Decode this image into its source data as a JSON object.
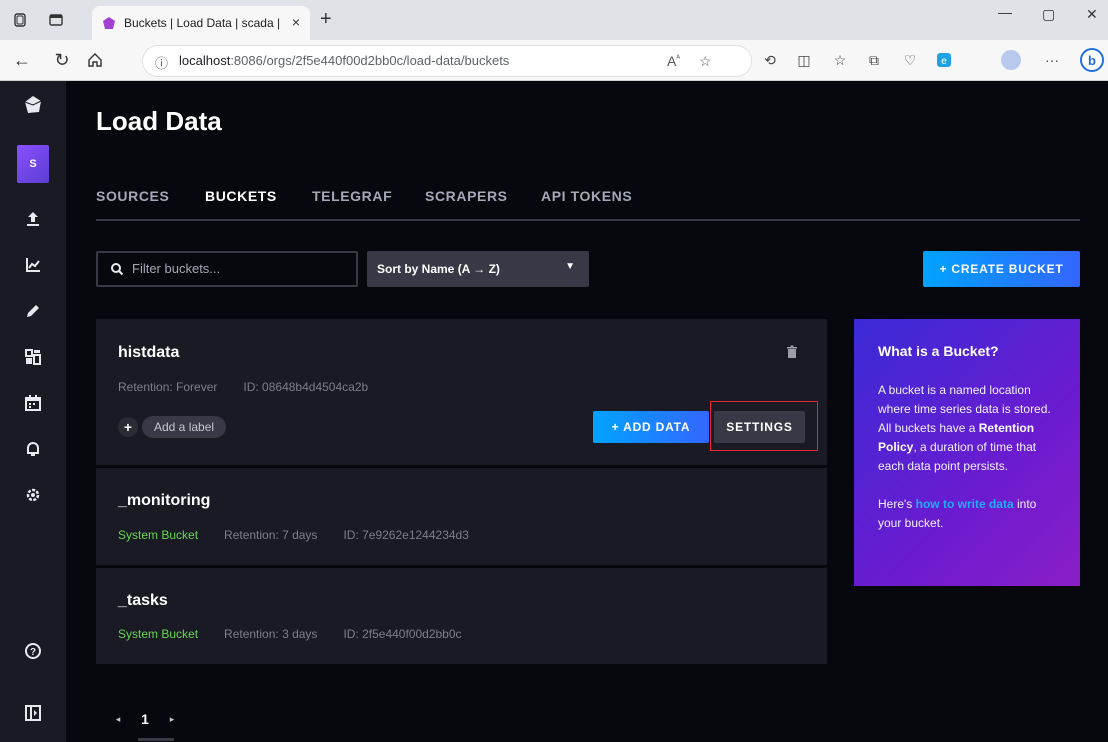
{
  "browser": {
    "tab_title": "Buckets | Load Data | scada | Influ",
    "new_tab": "+",
    "close_tab": "×",
    "url_host": "localhost",
    "url_path": ":8086/orgs/2f5e440f00d2bb0c/load-data/buckets",
    "window_controls": {
      "minimize": "—",
      "maximize": "▢",
      "close": "✕"
    }
  },
  "sidebar": {
    "org_initial": "S",
    "items": [
      {
        "icon": "influx-logo-icon"
      },
      {
        "icon": "upload-icon"
      },
      {
        "icon": "chart-icon"
      },
      {
        "icon": "pencil-icon"
      },
      {
        "icon": "dashboards-icon"
      },
      {
        "icon": "calendar-icon"
      },
      {
        "icon": "bell-icon"
      },
      {
        "icon": "gear-icon"
      },
      {
        "icon": "help-icon"
      },
      {
        "icon": "collapse-icon"
      }
    ]
  },
  "page": {
    "title": "Load Data",
    "tabs": [
      "SOURCES",
      "BUCKETS",
      "TELEGRAF",
      "SCRAPERS",
      "API TOKENS"
    ],
    "active_tab": "BUCKETS"
  },
  "controls": {
    "filter_placeholder": "Filter buckets...",
    "sort_label": "Sort by Name (A → Z)",
    "create_label": "+ CREATE BUCKET"
  },
  "buckets": [
    {
      "name": "histdata",
      "retention": "Retention: Forever",
      "id": "ID: 08648b4d4504ca2b",
      "add_label": "Add a label",
      "add_data": "+ ADD DATA",
      "settings": "SETTINGS"
    },
    {
      "name": "_monitoring",
      "system": "System Bucket",
      "retention": "Retention: 7 days",
      "id": "ID: 7e9262e1244234d3"
    },
    {
      "name": "_tasks",
      "system": "System Bucket",
      "retention": "Retention: 3 days",
      "id": "ID: 2f5e440f00d2bb0c"
    }
  ],
  "info": {
    "title": "What is a Bucket?",
    "p1_a": "A bucket is a named location where time series data is stored. All buckets have a ",
    "p1_bold": "Retention Policy",
    "p1_b": ", a duration of time that each data point persists.",
    "p2_a": "Here's ",
    "p2_link": "how to write data",
    "p2_b": " into your bucket."
  },
  "pagination": {
    "current": "1",
    "prev": "◂",
    "next": "▸"
  },
  "colors": {
    "accent": "#00a3ff",
    "highlight": "#e8262f",
    "system_bucket": "#67d74e",
    "panel": "#6b1bd0"
  }
}
